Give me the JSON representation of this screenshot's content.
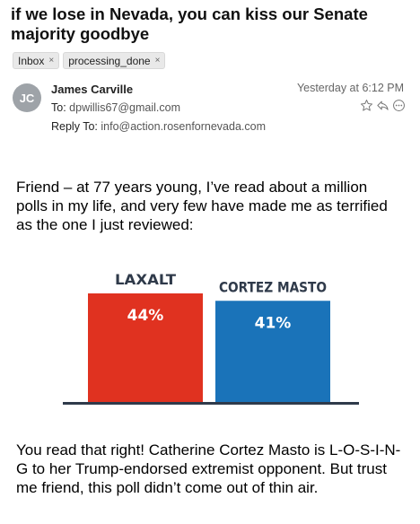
{
  "email": {
    "subject": "if we lose in Nevada, you can kiss our Senate majority goodbye",
    "tags": [
      "Inbox",
      "processing_done"
    ],
    "tag_remove_glyph": "×",
    "avatar_initials": "JC",
    "sender": "James Carville",
    "date": "Yesterday at 6:12 PM",
    "to_label": "To:",
    "to_value": "dpwillis67@gmail.com",
    "reply_to_label": "Reply To:",
    "reply_to_value": "info@action.rosenfornevada.com",
    "icons": [
      "star-icon",
      "reply-icon",
      "more-icon"
    ]
  },
  "body": {
    "paragraph1": "Friend – at 77 years young, I’ve read about a million polls in my life, and very few have made me as terrified as the one I just reviewed:",
    "paragraph2": "You read that right! Catherine Cortez Masto is L-O-S-I-N-G to her Trump-endorsed extremist opponent. But trust me friend, this poll didn’t come out of thin air."
  },
  "chart_data": {
    "type": "bar",
    "categories": [
      "LAXALT",
      "CORTEZ MASTO"
    ],
    "values": [
      44,
      41
    ],
    "value_labels": [
      "44%",
      "41%"
    ],
    "colors": [
      "#e03220",
      "#1a73b9"
    ],
    "ylim": [
      0,
      44
    ]
  }
}
